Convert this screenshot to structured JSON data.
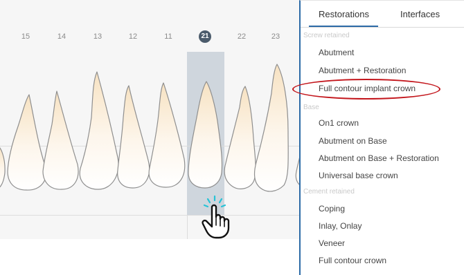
{
  "tooth_chart": {
    "tooth_numbers": [
      "15",
      "14",
      "13",
      "12",
      "11",
      "21",
      "22",
      "23"
    ],
    "selected_tooth": "21"
  },
  "menu": {
    "tabs": [
      {
        "label": "Restorations",
        "active": true
      },
      {
        "label": "Interfaces",
        "active": false
      }
    ],
    "groups": [
      {
        "label": "Screw retained",
        "items": [
          "Abutment",
          "Abutment + Restoration",
          "Full contour implant crown"
        ]
      },
      {
        "label": "Base",
        "items": [
          "On1 crown",
          "Abutment on Base",
          "Abutment on Base + Restoration",
          "Universal base crown"
        ]
      },
      {
        "label": "Cement retained",
        "items": [
          "Coping",
          "Inlay, Onlay",
          "Veneer",
          "Full contour crown"
        ]
      }
    ],
    "highlighted_item": "Full contour implant crown"
  },
  "colors": {
    "accent": "#2b6aa6",
    "highlight_ring": "#c3161c",
    "selected_column": "#cfd6dd",
    "cursor_cyan": "#27c3d6"
  },
  "icons": {
    "cursor": "hand-pointer-icon"
  }
}
